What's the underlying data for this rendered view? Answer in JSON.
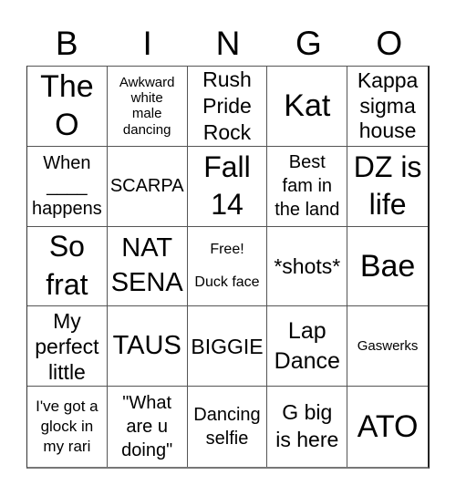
{
  "header": {
    "letters": [
      "B",
      "I",
      "N",
      "G",
      "O"
    ]
  },
  "cells": [
    {
      "text": "The\nO"
    },
    {
      "text": "Awkward\nwhite\nmale\ndancing"
    },
    {
      "text": "Rush\nPride\nRock"
    },
    {
      "text": "Kat"
    },
    {
      "text": "Kappa\nsigma\nhouse"
    },
    {
      "text": "When\n____\nhappens"
    },
    {
      "text": "SCARPA"
    },
    {
      "text": "Fall\n14"
    },
    {
      "text": "Best\nfam in\nthe land"
    },
    {
      "text": "DZ is\nlife"
    },
    {
      "text": "So\nfrat"
    },
    {
      "text": "NAT\nSENA"
    },
    {
      "free_label": "Free!",
      "text": "Duck face"
    },
    {
      "text": "*shots*"
    },
    {
      "text": "Bae"
    },
    {
      "text": "My\nperfect\nlittle"
    },
    {
      "text": "TAUS"
    },
    {
      "text": "BIGGIE"
    },
    {
      "text": "Lap\nDance"
    },
    {
      "text": "Gaswerks"
    },
    {
      "text": "I've got a\nglock in\nmy rari"
    },
    {
      "text": "\"What\nare u\ndoing\""
    },
    {
      "text": "Dancing\nselfie"
    },
    {
      "text": "G big\nis here"
    },
    {
      "text": "ATO"
    }
  ]
}
